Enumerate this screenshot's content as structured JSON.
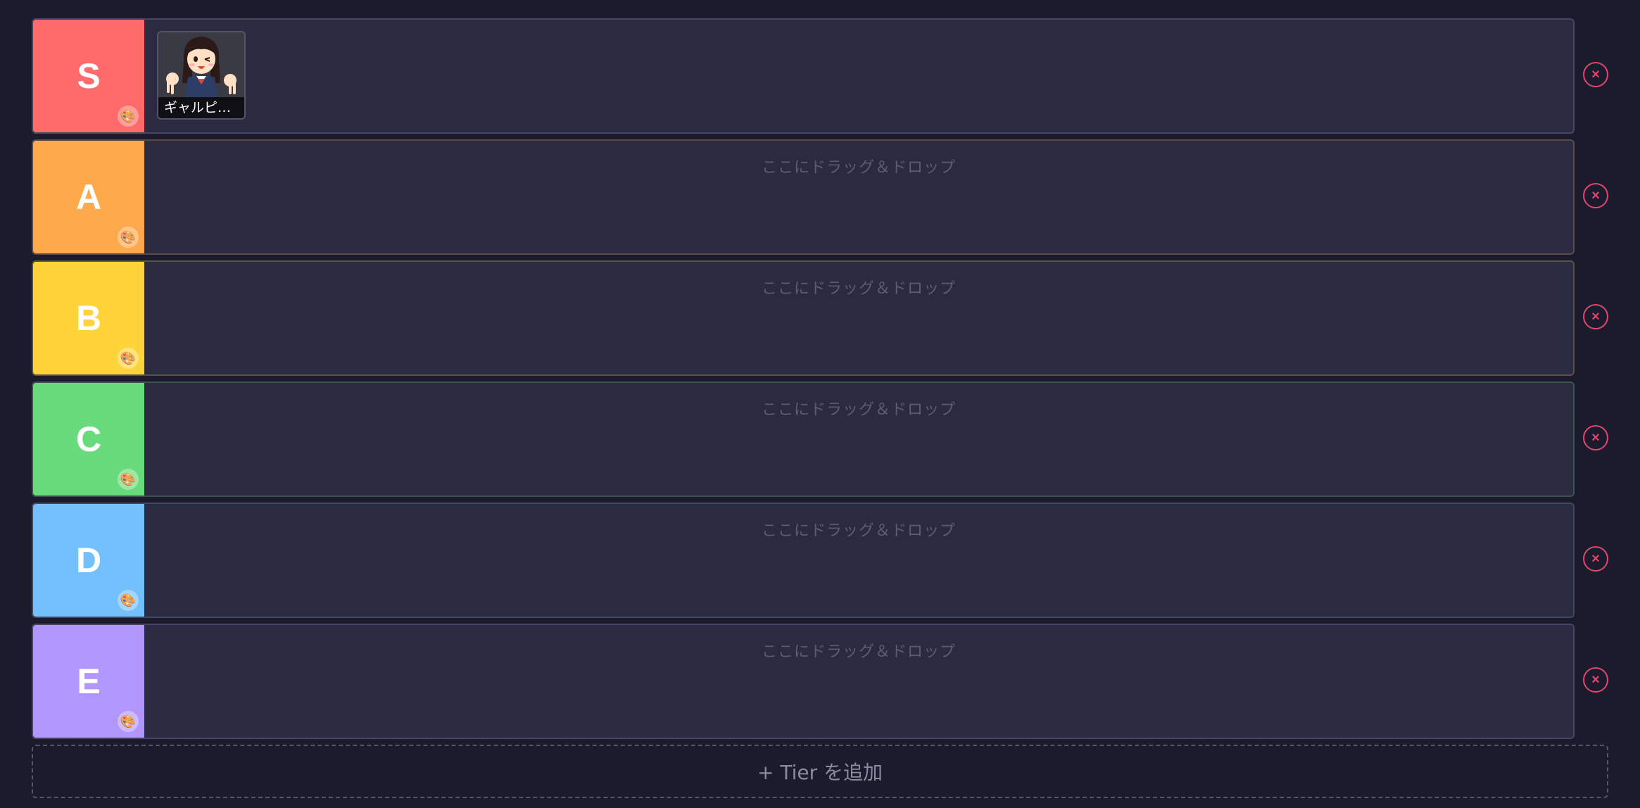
{
  "tiers": [
    {
      "label": "S",
      "color": "#ff6b6b",
      "items": [
        {
          "name": "ギャルピ…"
        }
      ],
      "drop_hint": ""
    },
    {
      "label": "A",
      "color": "#ffa94d",
      "items": [],
      "drop_hint": "ここにドラッグ＆ドロップ"
    },
    {
      "label": "B",
      "color": "#ffd43b",
      "items": [],
      "drop_hint": "ここにドラッグ＆ドロップ"
    },
    {
      "label": "C",
      "color": "#69db7c",
      "items": [],
      "drop_hint": "ここにドラッグ＆ドロップ"
    },
    {
      "label": "D",
      "color": "#74c0fc",
      "items": [],
      "drop_hint": "ここにドラッグ＆ドロップ"
    },
    {
      "label": "E",
      "color": "#b197fc",
      "items": [],
      "drop_hint": "ここにドラッグ＆ドロップ"
    }
  ],
  "palette_icon": "🎨",
  "remove_icon": "×",
  "add_tier_label": "+ Tier を追加"
}
